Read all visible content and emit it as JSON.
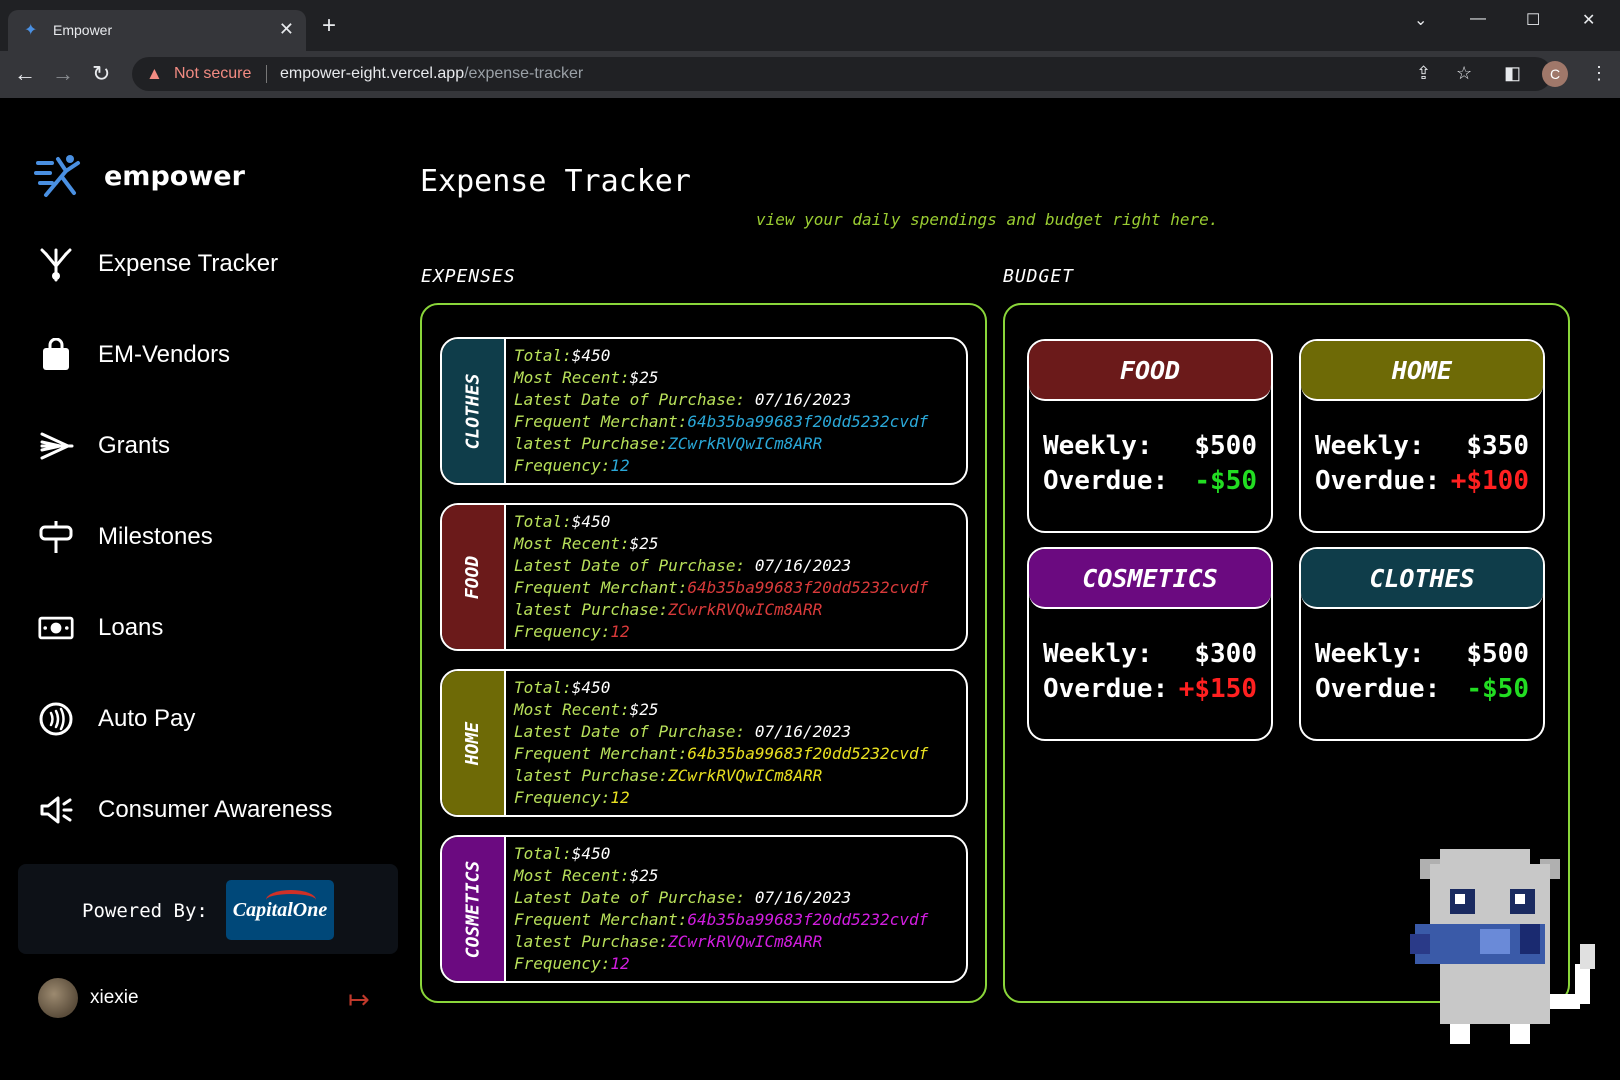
{
  "browser": {
    "tab_title": "Empower",
    "security_label": "Not secure",
    "url_host": "empower-eight.vercel.app",
    "url_path": "/expense-tracker",
    "profile_initial": "C"
  },
  "sidebar": {
    "brand": "empower",
    "items": [
      {
        "label": "Expense Tracker",
        "icon": "tree-icon"
      },
      {
        "label": "EM-Vendors",
        "icon": "shopping-bag-icon"
      },
      {
        "label": "Grants",
        "icon": "grants-icon"
      },
      {
        "label": "Milestones",
        "icon": "signpost-icon"
      },
      {
        "label": "Loans",
        "icon": "banknote-icon"
      },
      {
        "label": "Auto Pay",
        "icon": "contactless-icon"
      },
      {
        "label": "Consumer Awareness",
        "icon": "megaphone-icon"
      }
    ],
    "powered_by": "Powered By:",
    "partner_logo_text": "CapitalOne",
    "user": {
      "name": "xiexie"
    }
  },
  "main": {
    "title": "Expense Tracker",
    "subtitle": "view your daily spendings and budget right here.",
    "expenses_label": "EXPENSES",
    "budget_label": "BUDGET"
  },
  "expense_labels": {
    "total": "Total:",
    "most_recent": "Most Recent:",
    "latest_date": "Latest Date of Purchase: ",
    "merchant": "Frequent Merchant:",
    "latest_purchase": "latest Purchase:",
    "frequency": "Frequency:"
  },
  "expenses": [
    {
      "category": "CLOTHES",
      "color": "#0f3d4a",
      "accent": "#2aa8d8",
      "total": "$450",
      "most_recent": "$25",
      "latest_date": "07/16/2023",
      "merchant": "64b35ba99683f20dd5232cvdf",
      "latest_purchase": "ZCwrkRVQwICm8ARR",
      "frequency": "12"
    },
    {
      "category": "FOOD",
      "color": "#6b1a1a",
      "accent": "#d93a3a",
      "total": "$450",
      "most_recent": "$25",
      "latest_date": "07/16/2023",
      "merchant": "64b35ba99683f20dd5232cvdf",
      "latest_purchase": "ZCwrkRVQwICm8ARR",
      "frequency": "12"
    },
    {
      "category": "HOME",
      "color": "#6e6a06",
      "accent": "#e8e020",
      "total": "$450",
      "most_recent": "$25",
      "latest_date": "07/16/2023",
      "merchant": "64b35ba99683f20dd5232cvdf",
      "latest_purchase": "ZCwrkRVQwICm8ARR",
      "frequency": "12"
    },
    {
      "category": "COSMETICS",
      "color": "#6b0a80",
      "accent": "#d21ee0",
      "total": "$450",
      "most_recent": "$25",
      "latest_date": "07/16/2023",
      "merchant": "64b35ba99683f20dd5232cvdf",
      "latest_purchase": "ZCwrkRVQwICm8ARR",
      "frequency": "12"
    }
  ],
  "budget_labels": {
    "weekly": "Weekly:",
    "overdue": "Overdue:"
  },
  "budget": [
    {
      "category": "FOOD",
      "color": "#6b1a1a",
      "weekly": "$500",
      "overdue": "-$50",
      "overdue_status": "under"
    },
    {
      "category": "HOME",
      "color": "#6e6a06",
      "weekly": "$350",
      "overdue": "+$100",
      "overdue_status": "over"
    },
    {
      "category": "COSMETICS",
      "color": "#6b0a80",
      "weekly": "$300",
      "overdue": "+$150",
      "overdue_status": "over"
    },
    {
      "category": "CLOTHES",
      "color": "#0f3d4a",
      "weekly": "$500",
      "overdue": "-$50",
      "overdue_status": "under"
    }
  ]
}
